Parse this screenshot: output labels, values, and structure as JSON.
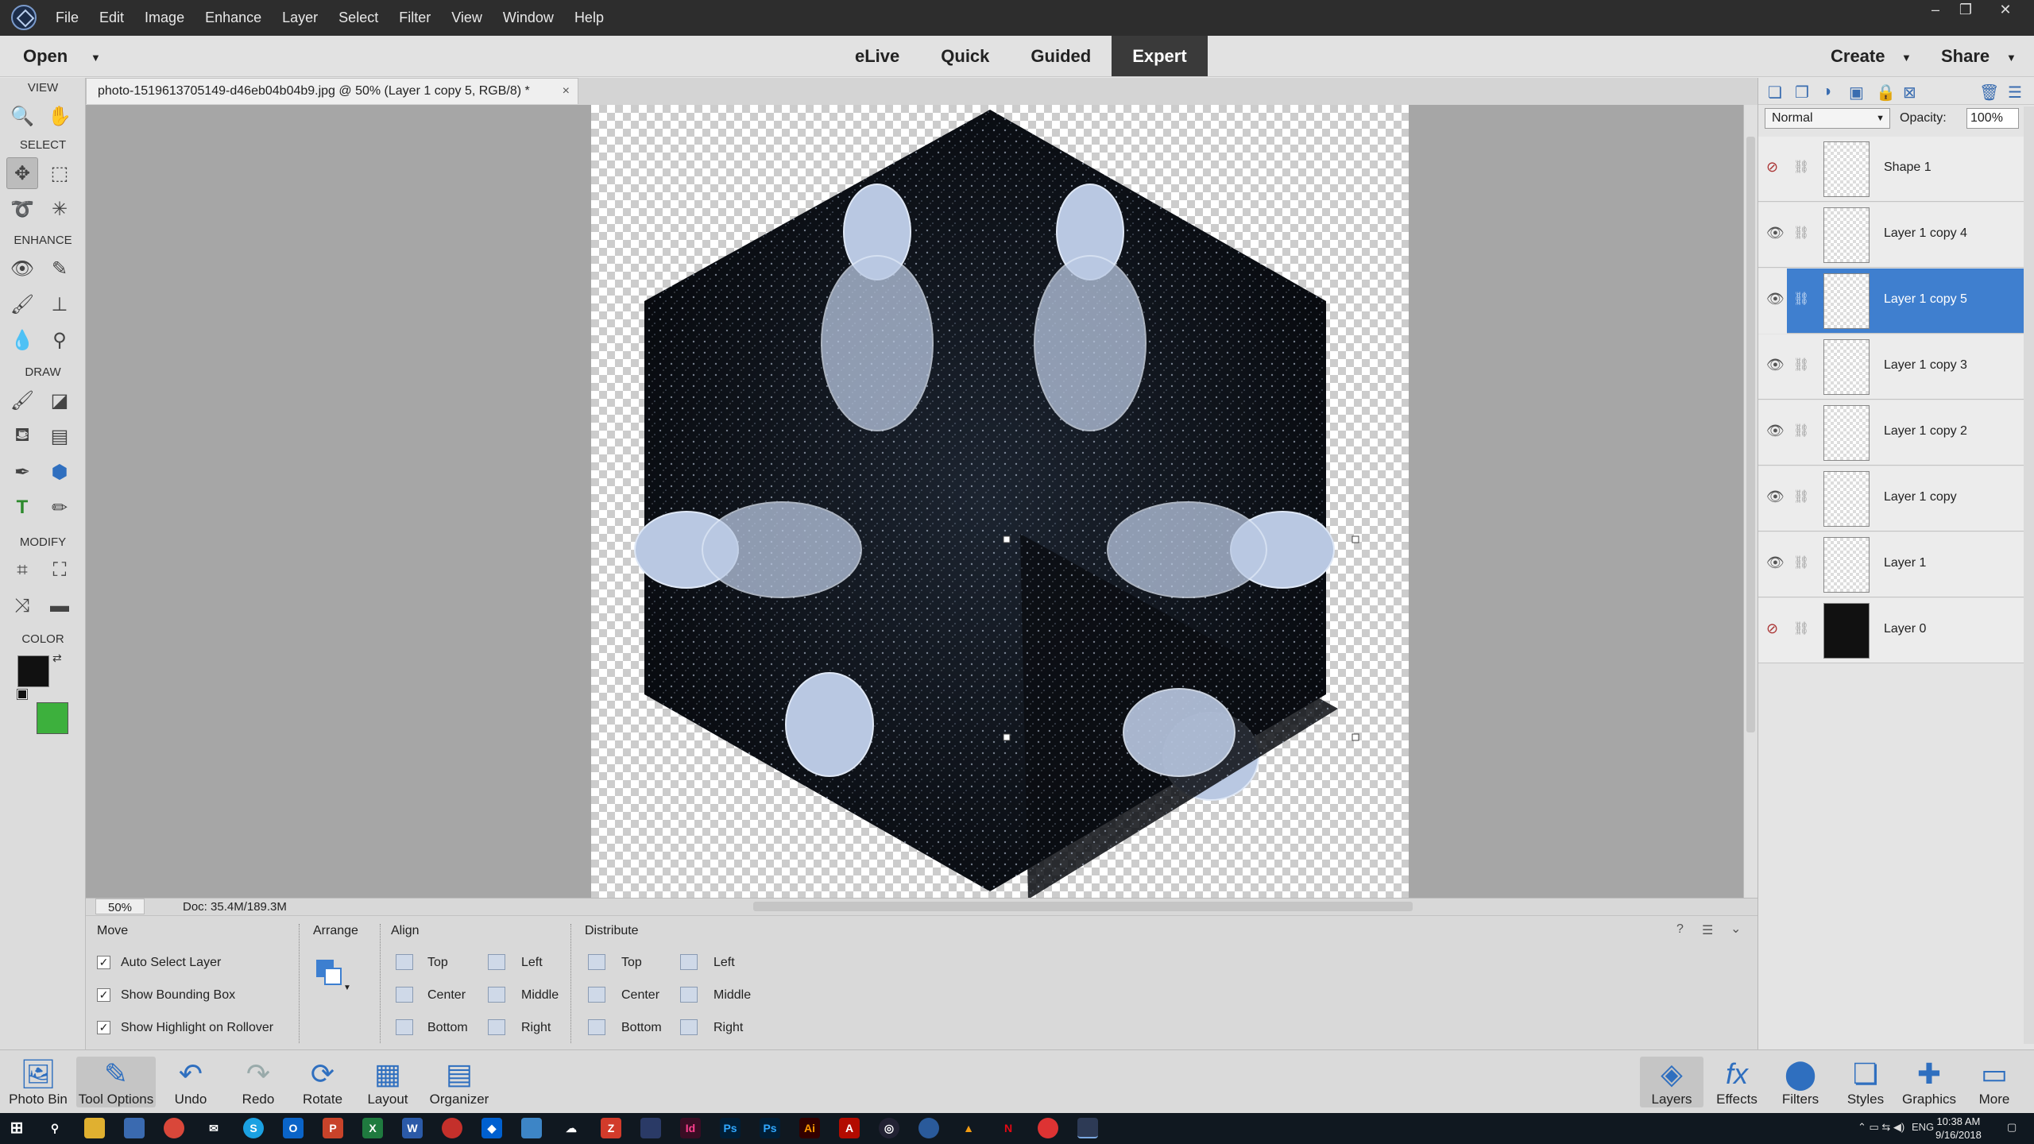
{
  "menubar": {
    "items": [
      "File",
      "Edit",
      "Image",
      "Enhance",
      "Layer",
      "Select",
      "Filter",
      "View",
      "Window",
      "Help"
    ],
    "window_controls": {
      "minimize": "–",
      "restore": "❐",
      "close": "✕"
    }
  },
  "modebar": {
    "open_label": "Open",
    "modes": [
      "eLive",
      "Quick",
      "Guided",
      "Expert"
    ],
    "active_mode": "Expert",
    "create_label": "Create",
    "share_label": "Share"
  },
  "toolbox": {
    "sections": [
      "VIEW",
      "SELECT",
      "ENHANCE",
      "DRAW",
      "MODIFY",
      "COLOR"
    ],
    "tools": [
      "zoom-icon",
      "hand-icon",
      "move-icon",
      "marquee-icon",
      "lasso-icon",
      "magic-wand-icon",
      "red-eye-icon",
      "spot-healing-icon",
      "smart-brush-icon",
      "clone-stamp-icon",
      "blur-icon",
      "sponge-icon",
      "brush-icon",
      "eraser-icon",
      "paint-bucket-icon",
      "gradient-icon",
      "eyedropper-icon",
      "shape-icon",
      "text-icon",
      "pencil-icon",
      "crop-icon",
      "recompose-icon",
      "content-aware-move-icon",
      "straighten-icon"
    ],
    "foreground_color": "#111111",
    "background_color": "#3db03d"
  },
  "document": {
    "tab_title": "photo-1519613705149-d46eb04b04b9.jpg @ 50% (Layer 1 copy 5, RGB/8) *",
    "close_label": "×"
  },
  "statusbar": {
    "zoom": "50%",
    "doc_size": "Doc: 35.4M/189.3M"
  },
  "tool_options": {
    "tool_name": "Move",
    "checkboxes": [
      {
        "label": "Auto Select Layer",
        "checked": true
      },
      {
        "label": "Show Bounding Box",
        "checked": true
      },
      {
        "label": "Show Highlight on Rollover",
        "checked": true
      }
    ],
    "arrange_label": "Arrange",
    "align_label": "Align",
    "align_items": [
      "Top",
      "Center",
      "Bottom",
      "Left",
      "Middle",
      "Right"
    ],
    "distribute_label": "Distribute",
    "distribute_items": [
      "Top",
      "Center",
      "Bottom",
      "Left",
      "Middle",
      "Right"
    ]
  },
  "layers_panel": {
    "blend_mode": "Normal",
    "opacity_label": "Opacity:",
    "opacity_value": "100%",
    "layers": [
      {
        "name": "Shape 1",
        "visible": false,
        "active": false
      },
      {
        "name": "Layer 1 copy 4",
        "visible": true,
        "active": false
      },
      {
        "name": "Layer 1 copy 5",
        "visible": true,
        "active": true
      },
      {
        "name": "Layer 1 copy 3",
        "visible": true,
        "active": false
      },
      {
        "name": "Layer 1 copy 2",
        "visible": true,
        "active": false
      },
      {
        "name": "Layer 1 copy",
        "visible": true,
        "active": false
      },
      {
        "name": "Layer 1",
        "visible": true,
        "active": false
      },
      {
        "name": "Layer 0",
        "visible": false,
        "active": false
      }
    ]
  },
  "panelbar": {
    "left": [
      "Photo Bin",
      "Tool Options",
      "Undo",
      "Redo",
      "Rotate",
      "Layout",
      "Organizer"
    ],
    "right": [
      "Layers",
      "Effects",
      "Filters",
      "Styles",
      "Graphics",
      "More"
    ]
  },
  "taskbar": {
    "language": "ENG",
    "time": "10:38 AM",
    "date": "9/16/2018"
  }
}
